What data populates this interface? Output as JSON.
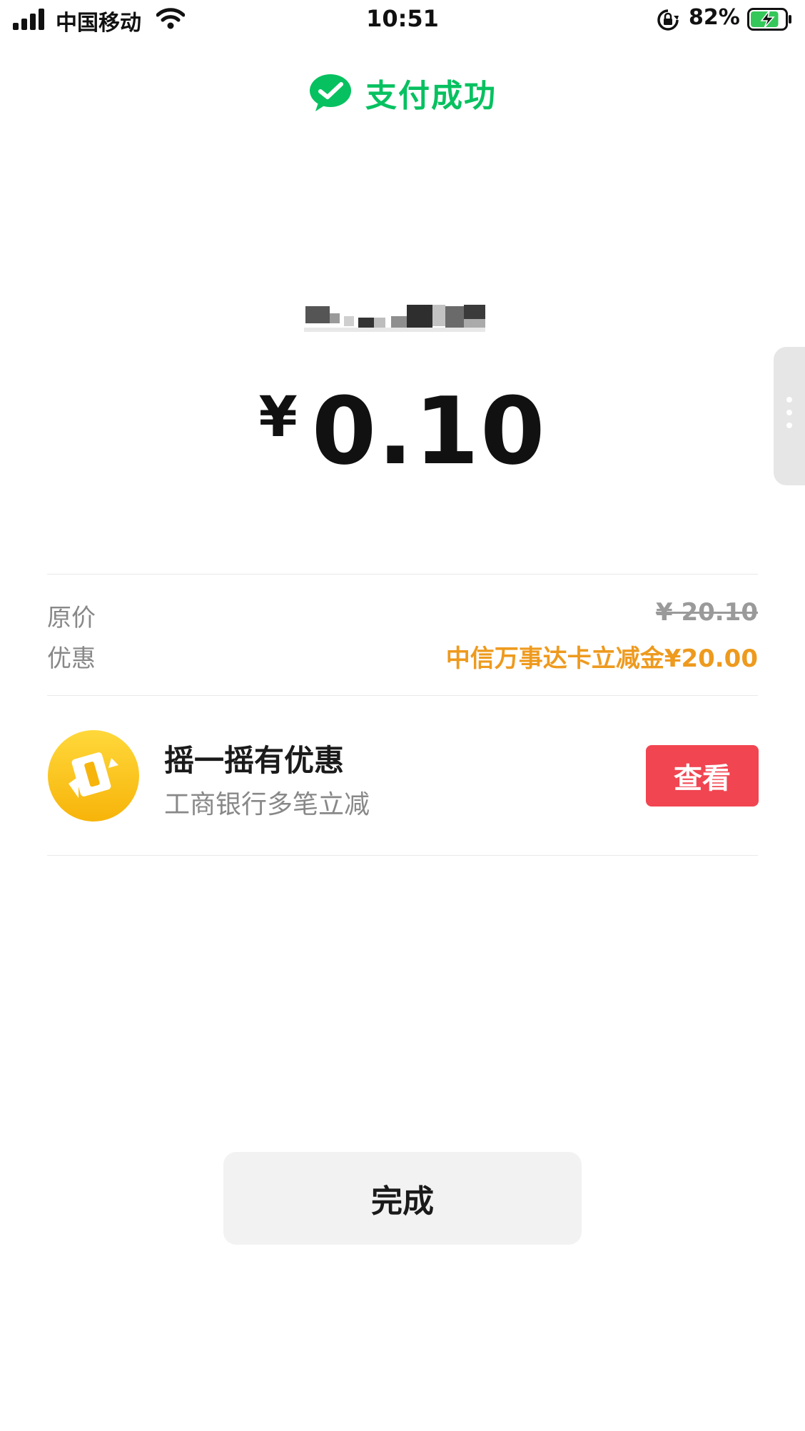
{
  "status_bar": {
    "carrier": "中国移动",
    "time": "10:51",
    "battery_percent": "82%",
    "battery_level": 0.82,
    "icons": [
      "signal-icon",
      "wifi-icon",
      "rotation-lock-icon",
      "battery-charging-icon"
    ]
  },
  "header": {
    "icon": "wechat-pay-icon",
    "title": "支付成功",
    "accent_color": "#07c160"
  },
  "payment": {
    "currency_symbol": "¥",
    "amount": "0.10"
  },
  "price_details": {
    "original_label": "原价",
    "original_value": "¥ 20.10",
    "discount_label": "优惠",
    "discount_value": "中信万事达卡立减金¥20.00",
    "discount_color": "#ee9a1e"
  },
  "promo": {
    "icon": "shake-coupon-icon",
    "title": "摇一摇有优惠",
    "subtitle": "工商银行多笔立减",
    "button_label": "查看",
    "button_color": "#f14551"
  },
  "done_button": {
    "label": "完成"
  }
}
